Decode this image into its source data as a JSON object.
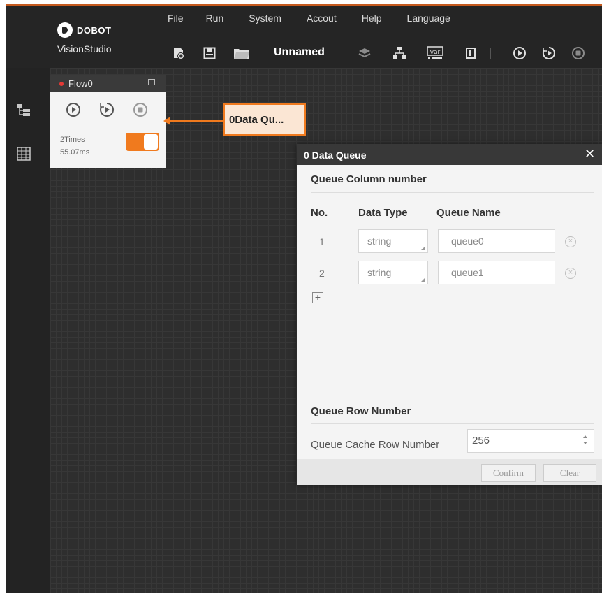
{
  "app": {
    "brand": "DOBOT",
    "product": "VisionStudio",
    "accent_color": "#f07a1e"
  },
  "menu": [
    "File",
    "Run",
    "System",
    "Accout",
    "Help",
    "Language"
  ],
  "toolbar": {
    "solution_name": "Unnamed",
    "icons": [
      "add-solution-icon",
      "save-icon",
      "open-folder-icon",
      "layers-icon",
      "hierarchy-icon",
      "variable-icon",
      "device-icon",
      "run-once-icon",
      "run-continuous-icon",
      "stop-icon"
    ]
  },
  "flow": {
    "title": "Flow0",
    "times": "2Times",
    "duration": "55.07ms",
    "enabled": true,
    "status_color": "#e53935"
  },
  "node": {
    "label": "0Data Qu..."
  },
  "dialog": {
    "title": "0 Data Queue",
    "close_glyph": "✕",
    "columns_section": "Queue Column number",
    "headers": {
      "no": "No.",
      "data_type": "Data Type",
      "queue_name": "Queue Name"
    },
    "rows": [
      {
        "no": "1",
        "data_type": "string",
        "queue_name": "queue0"
      },
      {
        "no": "2",
        "data_type": "string",
        "queue_name": "queue1"
      }
    ],
    "rows_section": "Queue Row Number",
    "cache_label": "Queue Cache Row Number",
    "cache_value": "256",
    "confirm_label": "Confirm",
    "clear_label": "Clear"
  }
}
